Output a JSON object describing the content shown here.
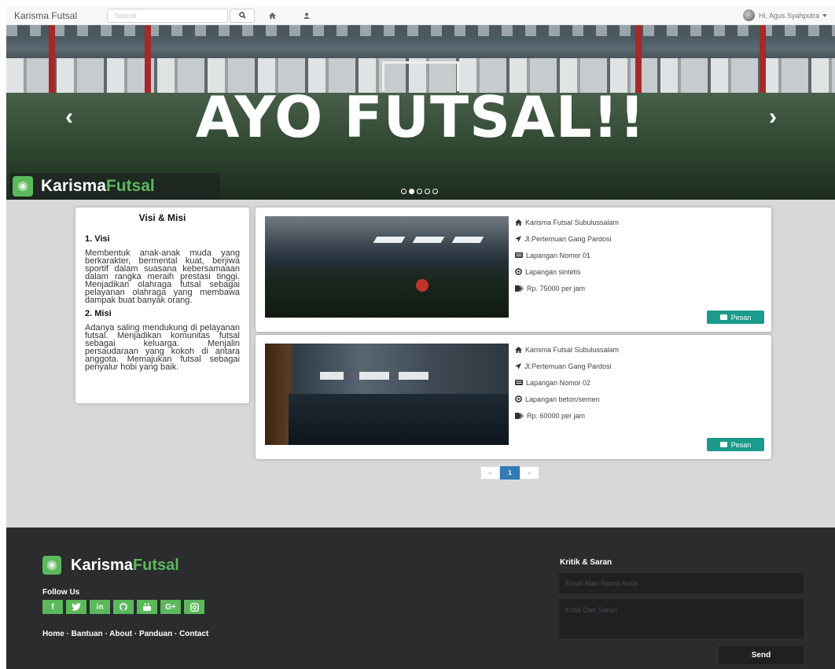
{
  "navbar": {
    "brand": "Karisma Futsal",
    "search_placeholder": "Search",
    "user_greeting": "Hi, Agus Syahputra"
  },
  "hero": {
    "title": "AYO FUTSAL!!",
    "prev_arrow": "‹",
    "next_arrow": "›",
    "logo_part1": "Karisma",
    "logo_part2": "Futsal",
    "slides": 5,
    "active_slide": 2
  },
  "visi_misi": {
    "title": "Visi & Misi",
    "visi_heading": "1. Visi",
    "visi_text": "Membentuk anak-anak muda yang berkarakter, bermental kuat, berjiwa sportif dalam suasana kebersamaaan dalam rangka meraih prestasi tinggi. Menjadikan olahraga futsal sebagai pelayanan olahraga yang membawa dampak buat banyak orang.",
    "misi_heading": "2. Misi",
    "misi_text": "Adanya saling mendukung di pelayanan futsal. Menjadikan komunitas futsal sebagai keluarga. Menjalin persaudaraan yang kokoh di antara anggota. Memajukan futsal sebagai penyalur hobi yang baik."
  },
  "courts": [
    {
      "name": "Karisma Futsal Subulussalam",
      "address": "Jl.Pertemuan Gang Pardosi",
      "court_no": "Lapangan Nomor 01",
      "type": "Lapangan sintetis",
      "price": "Rp. 75000 per jam",
      "button": "Pesan"
    },
    {
      "name": "Karisma Futsal Subulussalam",
      "address": "Jl.Pertemuan Gang Pardosi",
      "court_no": "Lapangan Nomor 02",
      "type": "Lapangan beton/semen",
      "price": "Rp. 60000 per jam",
      "button": "Pesan"
    }
  ],
  "pagination": {
    "prev": "«",
    "current": "1",
    "next": "»"
  },
  "footer": {
    "logo_part1": "Karisma",
    "logo_part2": "Futsal",
    "follow_us": "Follow Us",
    "social": [
      "f",
      "t",
      "in",
      "gh",
      "yt",
      "G+",
      "ig"
    ],
    "links": "Home · Bantuan · About · Panduan · Contact",
    "kritik_title": "Kritik & Saran",
    "email_placeholder": "Email Atau Nama Anda",
    "message_placeholder": "Kritik Dan Saran",
    "send": "Send"
  },
  "colors": {
    "accent_green": "#5cb85c",
    "button_teal": "#1a9b8c",
    "pager_blue": "#337ab7",
    "footer_bg": "#2a2c2e"
  }
}
